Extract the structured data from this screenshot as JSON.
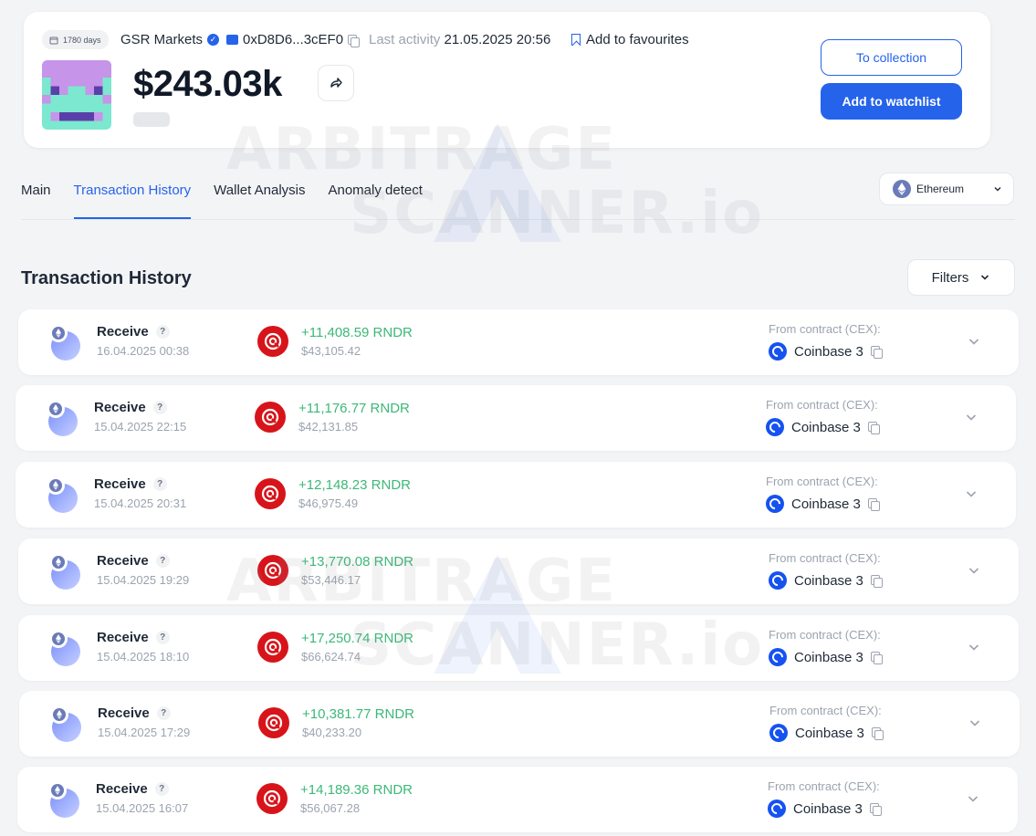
{
  "header": {
    "days_badge": "1780 days",
    "wallet_name": "GSR Markets",
    "address": "0xD8D6...3cEF0",
    "last_activity_label": "Last activity",
    "last_activity_value": "21.05.2025 20:56",
    "favourites_label": "Add to favourites",
    "balance": "$243.03k",
    "to_collection_label": "To collection",
    "add_watchlist_label": "Add to watchlist"
  },
  "tabs": [
    {
      "label": "Main"
    },
    {
      "label": "Transaction History"
    },
    {
      "label": "Wallet Analysis"
    },
    {
      "label": "Anomaly detect"
    }
  ],
  "network": {
    "label": "Ethereum",
    "icon": "ethereum-icon"
  },
  "section": {
    "title": "Transaction History",
    "filters_label": "Filters"
  },
  "watermark": {
    "line1": "ARBITRAGE",
    "line2": "SCANNER.io"
  },
  "accent_color": "#2563eb",
  "positive_color": "#3cb878",
  "transactions": [
    {
      "type": "Receive",
      "date": "16.04.2025 00:38",
      "amount": "+11,408.59 RNDR",
      "usd": "$43,105.42",
      "from_label": "From contract (CEX):",
      "from": "Coinbase 3"
    },
    {
      "type": "Receive",
      "date": "15.04.2025 22:15",
      "amount": "+11,176.77 RNDR",
      "usd": "$42,131.85",
      "from_label": "From contract (CEX):",
      "from": "Coinbase 3"
    },
    {
      "type": "Receive",
      "date": "15.04.2025 20:31",
      "amount": "+12,148.23 RNDR",
      "usd": "$46,975.49",
      "from_label": "From contract (CEX):",
      "from": "Coinbase 3"
    },
    {
      "type": "Receive",
      "date": "15.04.2025 19:29",
      "amount": "+13,770.08 RNDR",
      "usd": "$53,446.17",
      "from_label": "From contract (CEX):",
      "from": "Coinbase 3"
    },
    {
      "type": "Receive",
      "date": "15.04.2025 18:10",
      "amount": "+17,250.74 RNDR",
      "usd": "$66,624.74",
      "from_label": "From contract (CEX):",
      "from": "Coinbase 3"
    },
    {
      "type": "Receive",
      "date": "15.04.2025 17:29",
      "amount": "+10,381.77 RNDR",
      "usd": "$40,233.20",
      "from_label": "From contract (CEX):",
      "from": "Coinbase 3"
    },
    {
      "type": "Receive",
      "date": "15.04.2025 16:07",
      "amount": "+14,189.36 RNDR",
      "usd": "$56,067.28",
      "from_label": "From contract (CEX):",
      "from": "Coinbase 3"
    }
  ]
}
